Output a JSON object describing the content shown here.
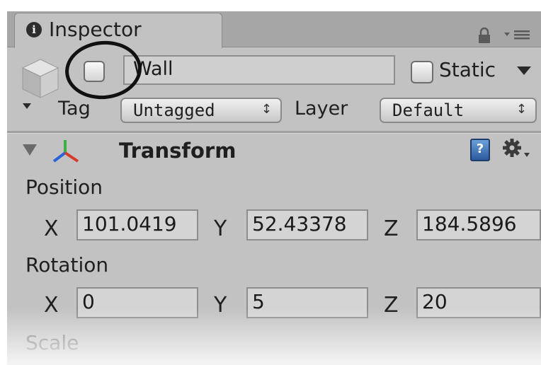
{
  "tab": {
    "title": "Inspector"
  },
  "header": {
    "active_checked": false,
    "name": "Wall",
    "static_label": "Static",
    "static_checked": false,
    "tag_label": "Tag",
    "tag_value": "Untagged",
    "layer_label": "Layer",
    "layer_value": "Default"
  },
  "component": {
    "title": "Transform",
    "position": {
      "label": "Position",
      "x_label": "X",
      "y_label": "Y",
      "z_label": "Z",
      "x": "101.0419",
      "y": "52.43378",
      "z": "184.5896"
    },
    "rotation": {
      "label": "Rotation",
      "x_label": "X",
      "y_label": "Y",
      "z_label": "Z",
      "x": "0",
      "y": "5",
      "z": "20"
    },
    "scale": {
      "label": "Scale"
    }
  },
  "colors": {
    "panel_bg": "#c2c2c2",
    "tab_strip": "#a6a6a6",
    "help_blue": "#2c5a9e"
  },
  "icons": [
    "info-icon",
    "lock-icon",
    "tab-menu-icon",
    "game-object-icon",
    "dropdown-arrow-icon",
    "foldout-icon",
    "transform-icon",
    "help-icon",
    "gear-icon"
  ]
}
